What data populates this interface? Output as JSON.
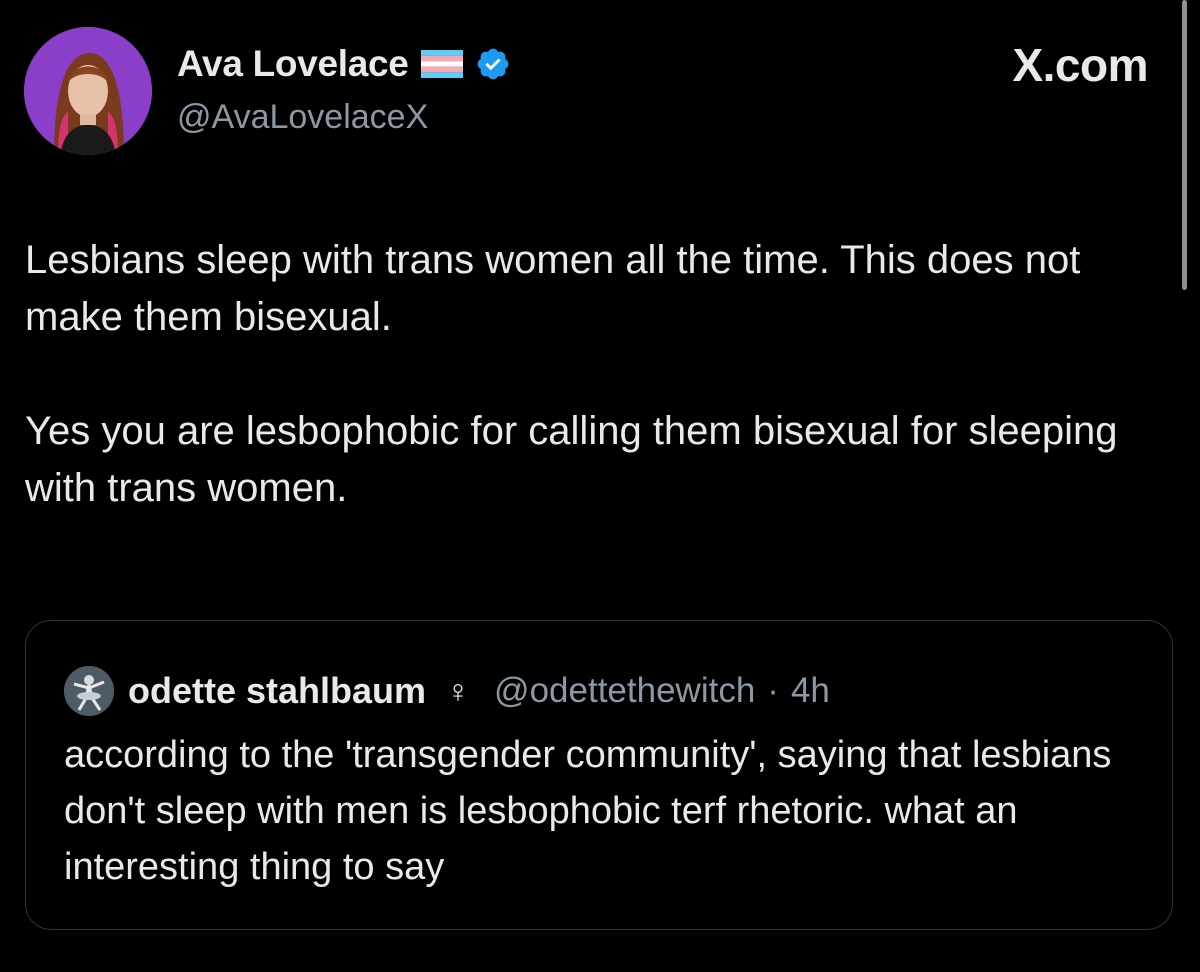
{
  "author": {
    "display_name": "Ava Lovelace",
    "handle": "@AvaLovelaceX",
    "flag_icon": "trans-pride-flag-icon",
    "verified_icon": "verified-badge-icon",
    "verified_color": "#1d9bf0",
    "avatar_bg": "#8b3fc9"
  },
  "brand": {
    "label": "X.com"
  },
  "tweet": {
    "paragraphs": [
      "Lesbians sleep with trans women all the time. This does not make them bisexual.",
      "Yes you are lesbophobic for calling them bisexual for sleeping with trans women."
    ]
  },
  "quoted": {
    "display_name": "odette stahlbaum",
    "symbol": "♀",
    "handle": "@odettethewitch",
    "separator": "·",
    "time": "4h",
    "text": "according to the 'transgender community', saying that lesbians don't sleep with men is lesbophobic terf rhetoric. what an interesting thing to say"
  },
  "colors": {
    "background": "#000000",
    "text": "#e7e9ea",
    "secondary_text": "#8b98a5",
    "border": "#2f3336"
  }
}
